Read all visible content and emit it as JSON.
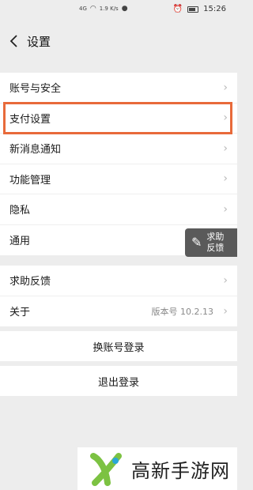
{
  "status_bar": {
    "network_text": "4G",
    "speed_text": "1.9 K/s",
    "time": "15:26"
  },
  "nav": {
    "back_icon": "chevron-left",
    "title": "设置"
  },
  "section1": {
    "items": [
      {
        "label": "账号与安全"
      },
      {
        "label": "支付设置"
      },
      {
        "label": "新消息通知"
      },
      {
        "label": "功能管理"
      },
      {
        "label": "隐私"
      },
      {
        "label": "通用"
      }
    ]
  },
  "section2": {
    "items": [
      {
        "label": "求助反馈"
      },
      {
        "label": "关于",
        "value": "版本号 10.2.13"
      }
    ]
  },
  "actions": {
    "switch_account": "换账号登录",
    "logout": "退出登录"
  },
  "help_float": {
    "line1": "求助",
    "line2": "反馈"
  },
  "watermark": {
    "text": "高新手游网"
  },
  "colors": {
    "highlight": "#e86a3a",
    "background": "#ededed"
  }
}
